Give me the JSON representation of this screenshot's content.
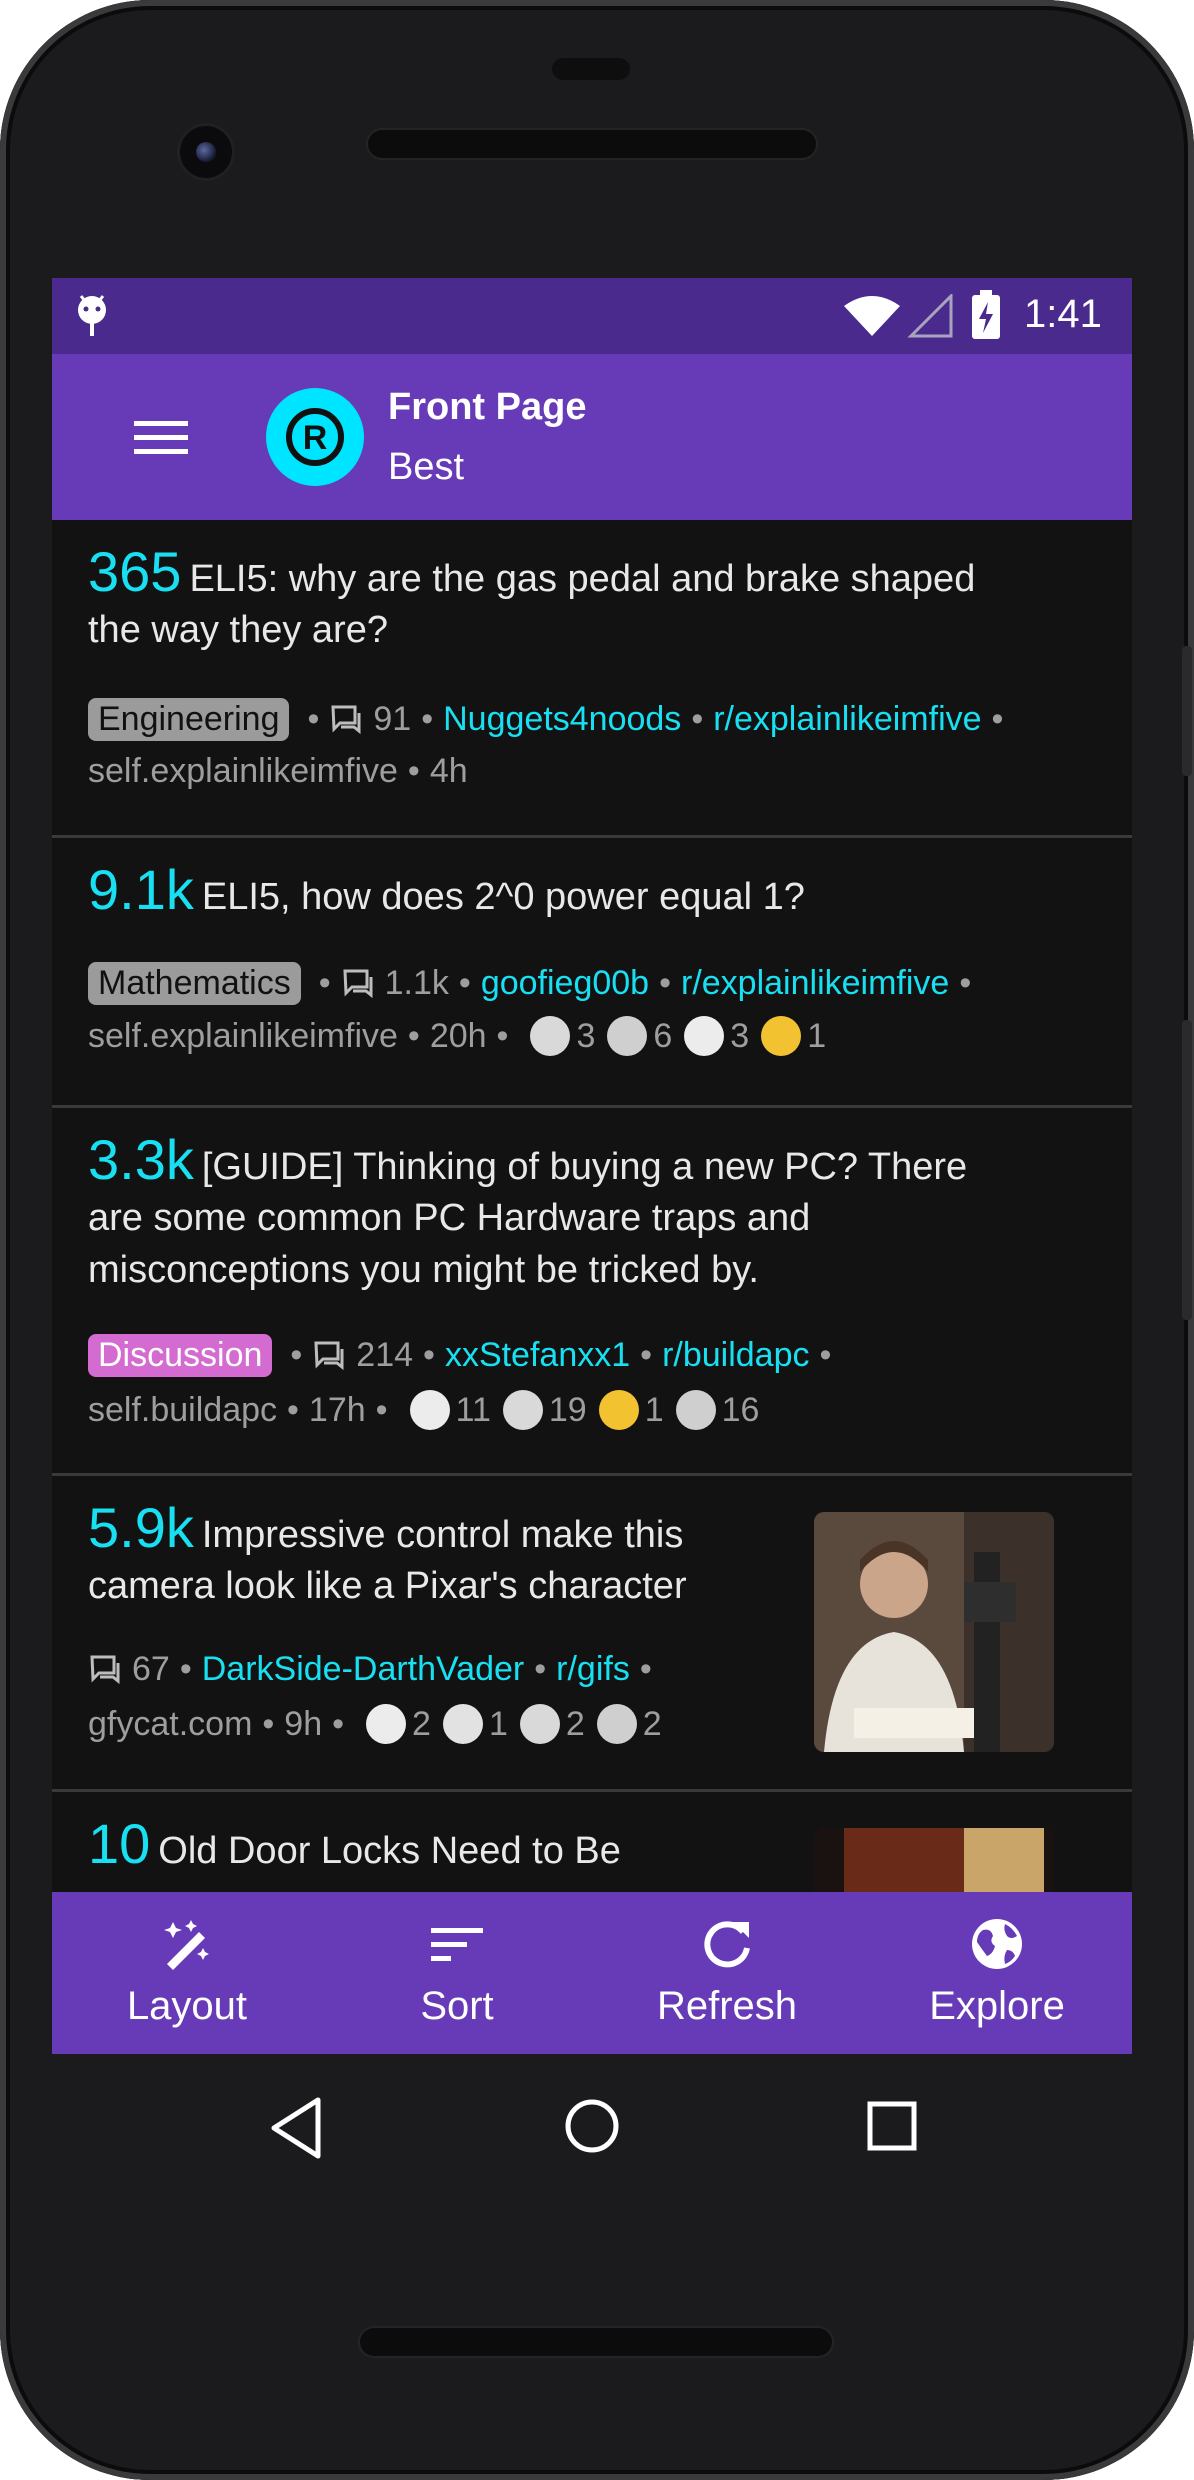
{
  "status_bar": {
    "time": "1:41"
  },
  "app_bar": {
    "title": "Front Page",
    "subtitle": "Best"
  },
  "posts": [
    {
      "score": "365",
      "title_lines": [
        "ELI5: why are the gas pedal and brake shaped",
        "the way they are?"
      ],
      "flair": "Engineering",
      "comments": "91",
      "author": "Nuggets4noods",
      "subreddit": "r/explainlikeimfive",
      "domain": "self.explainlikeimfive",
      "age": "4h",
      "awards": []
    },
    {
      "score": "9.1k",
      "title_lines": [
        "ELI5, how does 2^0 power equal 1?"
      ],
      "flair": "Mathematics",
      "comments": "1.1k",
      "author": "goofieg00b",
      "subreddit": "r/explainlikeimfive",
      "domain": "self.explainlikeimfive",
      "age": "20h",
      "awards": [
        "3",
        "6",
        "3",
        "1"
      ]
    },
    {
      "score": "3.3k",
      "title_lines": [
        "[GUIDE] Thinking of buying a new PC? There",
        "are some common PC Hardware traps and",
        "misconceptions you might be tricked by."
      ],
      "flair": "Discussion",
      "comments": "214",
      "author": "xxStefanxx1",
      "subreddit": "r/buildapc",
      "domain": "self.buildapc",
      "age": "17h",
      "awards": [
        "11",
        "19",
        "1",
        "16"
      ]
    },
    {
      "score": "5.9k",
      "title_lines": [
        "Impressive control make this",
        "camera look like a Pixar's character"
      ],
      "comments": "67",
      "author": "DarkSide-DarthVader",
      "subreddit": "r/gifs",
      "domain": "gfycat.com",
      "age": "9h",
      "awards": [
        "2",
        "1",
        "2",
        "2"
      ]
    },
    {
      "score": "10",
      "title_lines": [
        "Old Door Locks Need to Be"
      ]
    }
  ],
  "bottom_nav": [
    {
      "label": "Layout",
      "icon": "wand-icon"
    },
    {
      "label": "Sort",
      "icon": "sort-icon"
    },
    {
      "label": "Refresh",
      "icon": "refresh-icon"
    },
    {
      "label": "Explore",
      "icon": "globe-icon"
    }
  ],
  "colors": {
    "accent": "#18e0f2",
    "primary": "#673ab7",
    "status_bar": "#4a2a8d",
    "flair_discussion": "#d46bd1"
  }
}
